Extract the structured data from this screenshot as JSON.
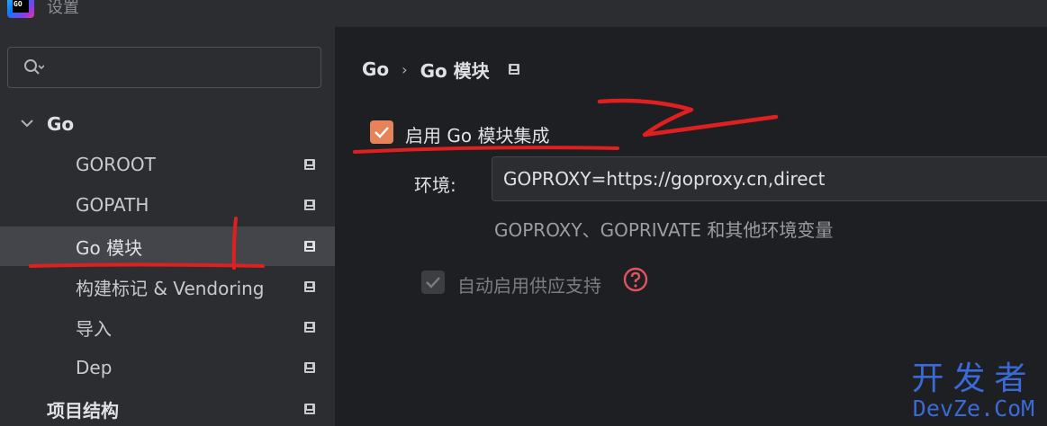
{
  "window": {
    "title": "设置",
    "logo_text": "GO"
  },
  "search": {
    "placeholder": "",
    "value": ""
  },
  "sidebar": {
    "group": {
      "label": "Go",
      "expanded": true
    },
    "items": [
      {
        "label": "GOROOT"
      },
      {
        "label": "GOPATH"
      },
      {
        "label": "Go 模块",
        "selected": true
      },
      {
        "label": "构建标记 & Vendoring"
      },
      {
        "label": "导入"
      },
      {
        "label": "Dep"
      }
    ],
    "footer_item": {
      "label": "项目结构"
    }
  },
  "main": {
    "breadcrumb": {
      "parent": "Go",
      "separator": "›",
      "current": "Go 模块"
    },
    "enable_modules": {
      "label": "启用 Go 模块集成",
      "checked": true
    },
    "environment": {
      "label": "环境:",
      "value": "GOPROXY=https://goproxy.cn,direct",
      "hint": "GOPROXY、GOPRIVATE 和其他环境变量"
    },
    "vendoring": {
      "label": "自动启用供应支持",
      "checked": true,
      "disabled": true
    }
  },
  "annotations": {
    "color": "#e02020",
    "marks": [
      "1",
      "2"
    ]
  },
  "watermark": {
    "line1": "开发者",
    "line2": "DevZe.CoM",
    "color": "#3a6ad8"
  },
  "colors": {
    "sidebar_bg": "#2b2d30",
    "main_bg": "#1e1f22",
    "selection": "#43454a",
    "checkbox_accent": "#e6835a",
    "help": "#e0555d"
  }
}
